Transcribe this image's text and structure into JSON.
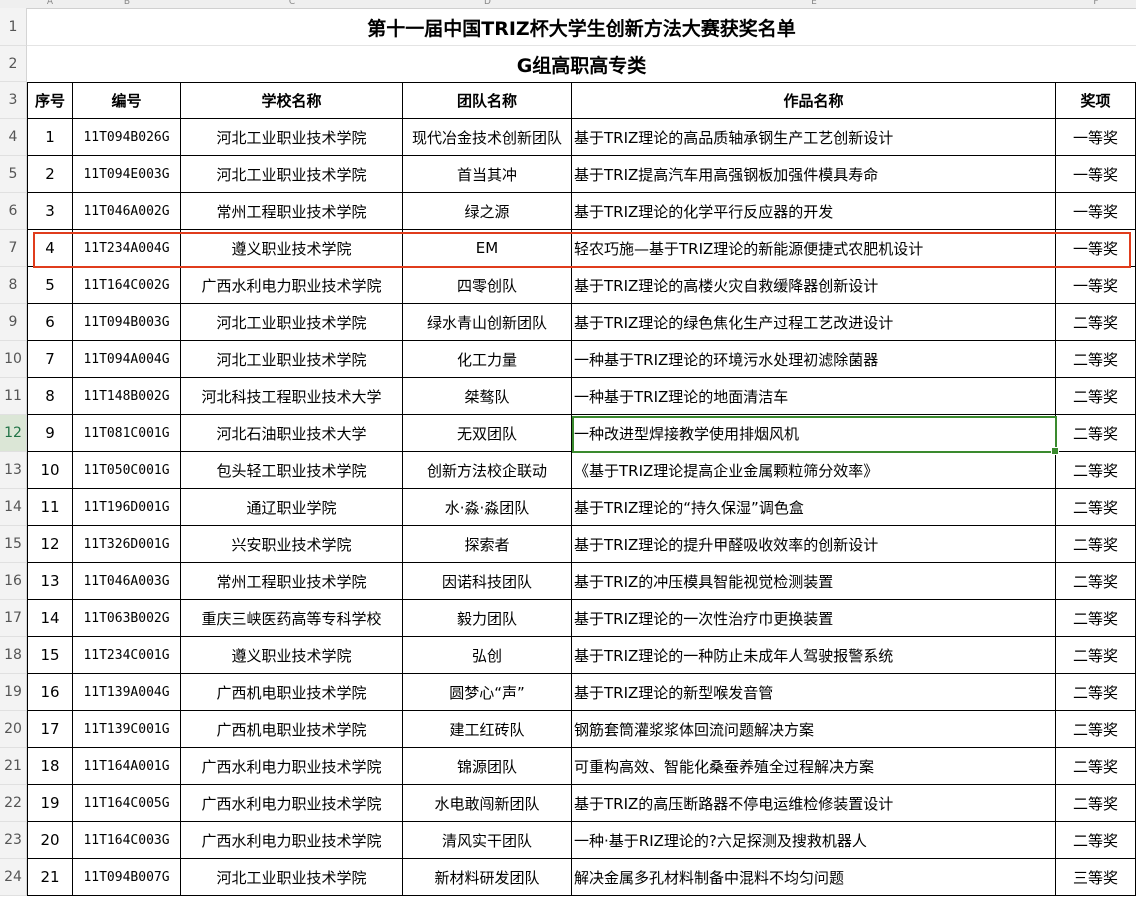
{
  "sheet": {
    "col_letters": [
      "A",
      "B",
      "C",
      "D",
      "E",
      "F"
    ],
    "title": "第十一届中国TRIZ杯大学生创新方法大赛获奖名单",
    "subtitle": "G组高职高专类",
    "row_numbers": [
      "1",
      "2",
      "3",
      "4",
      "5",
      "6",
      "7",
      "8",
      "9",
      "10",
      "11",
      "12",
      "13",
      "14",
      "15",
      "16",
      "17",
      "18",
      "19",
      "20",
      "21",
      "22",
      "23",
      "24"
    ],
    "headers": [
      "序号",
      "编号",
      "学校名称",
      "团队名称",
      "作品名称",
      "奖项"
    ],
    "rows": [
      [
        "1",
        "11T094B026G",
        "河北工业职业技术学院",
        "现代冶金技术创新团队",
        "基于TRIZ理论的高品质轴承钢生产工艺创新设计",
        "一等奖"
      ],
      [
        "2",
        "11T094E003G",
        "河北工业职业技术学院",
        "首当其冲",
        "基于TRIZ提高汽车用高强钢板加强件模具寿命",
        "一等奖"
      ],
      [
        "3",
        "11T046A002G",
        "常州工程职业技术学院",
        "绿之源",
        "基于TRIZ理论的化学平行反应器的开发",
        "一等奖"
      ],
      [
        "4",
        "11T234A004G",
        "遵义职业技术学院",
        "EM",
        "轻农巧施—基于TRIZ理论的新能源便捷式农肥机设计",
        "一等奖"
      ],
      [
        "5",
        "11T164C002G",
        "广西水利电力职业技术学院",
        "四零创队",
        "基于TRIZ理论的高楼火灾自救缓降器创新设计",
        "一等奖"
      ],
      [
        "6",
        "11T094B003G",
        "河北工业职业技术学院",
        "绿水青山创新团队",
        "基于TRIZ理论的绿色焦化生产过程工艺改进设计",
        "二等奖"
      ],
      [
        "7",
        "11T094A004G",
        "河北工业职业技术学院",
        "化工力量",
        "一种基于TRIZ理论的环境污水处理初滤除菌器",
        "二等奖"
      ],
      [
        "8",
        "11T148B002G",
        "河北科技工程职业技术大学",
        "桀骜队",
        "一种基于TRIZ理论的地面清洁车",
        "二等奖"
      ],
      [
        "9",
        "11T081C001G",
        "河北石油职业技术大学",
        "无双团队",
        "一种改进型焊接教学使用排烟风机",
        "二等奖"
      ],
      [
        "10",
        "11T050C001G",
        "包头轻工职业技术学院",
        "创新方法校企联动",
        "《基于TRIZ理论提高企业金属颗粒筛分效率》",
        "二等奖"
      ],
      [
        "11",
        "11T196D001G",
        "通辽职业学院",
        "水·淼·淼团队",
        "基于TRIZ理论的“持久保湿”调色盒",
        "二等奖"
      ],
      [
        "12",
        "11T326D001G",
        "兴安职业技术学院",
        "探索者",
        "基于TRIZ理论的提升甲醛吸收效率的创新设计",
        "二等奖"
      ],
      [
        "13",
        "11T046A003G",
        "常州工程职业技术学院",
        "因诺科技团队",
        "基于TRIZ的冲压模具智能视觉检测装置",
        "二等奖"
      ],
      [
        "14",
        "11T063B002G",
        "重庆三峡医药高等专科学校",
        "毅力团队",
        "基于TRIZ理论的一次性治疗巾更换装置",
        "二等奖"
      ],
      [
        "15",
        "11T234C001G",
        "遵义职业技术学院",
        "弘创",
        "基于TRIZ理论的一种防止未成年人驾驶报警系统",
        "二等奖"
      ],
      [
        "16",
        "11T139A004G",
        "广西机电职业技术学院",
        "圆梦心“声”",
        "基于TRIZ理论的新型喉发音管",
        "二等奖"
      ],
      [
        "17",
        "11T139C001G",
        "广西机电职业技术学院",
        "建工红砖队",
        "钢筋套筒灌浆浆体回流问题解决方案",
        "二等奖"
      ],
      [
        "18",
        "11T164A001G",
        "广西水利电力职业技术学院",
        "锦源团队",
        "可重构高效、智能化桑蚕养殖全过程解决方案",
        "二等奖"
      ],
      [
        "19",
        "11T164C005G",
        "广西水利电力职业技术学院",
        "水电敢闯新团队",
        "基于TRIZ的高压断路器不停电运维检修装置设计",
        "二等奖"
      ],
      [
        "20",
        "11T164C003G",
        "广西水利电力职业技术学院",
        "清风实干团队",
        "一种·基于RIZ理论的?六足探测及搜救机器人",
        "二等奖"
      ],
      [
        "21",
        "11T094B007G",
        "河北工业职业技术学院",
        "新材料研发团队",
        "解决金属多孔材料制备中混料不均匀问题",
        "三等奖"
      ]
    ],
    "selected_row": "12",
    "colors": {
      "highlight_row_border": "#e03c1c",
      "selection_border": "#3a8a2e",
      "grid": "#000000"
    }
  }
}
